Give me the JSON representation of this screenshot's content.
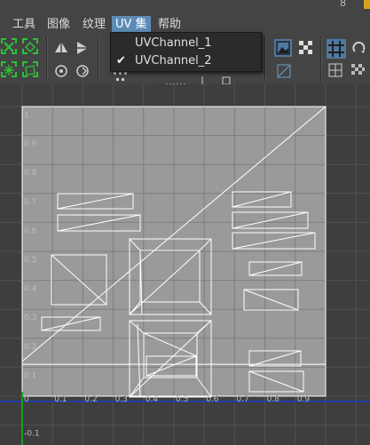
{
  "title_fragment": "8",
  "menu": [
    {
      "label": "工具",
      "active": false
    },
    {
      "label": "图像",
      "active": false
    },
    {
      "label": "纹理",
      "active": false
    },
    {
      "label": "UV 集",
      "active": true
    },
    {
      "label": "帮助",
      "active": false
    }
  ],
  "uv_set_menu": {
    "items": [
      {
        "label": "UVChannel_1",
        "checked": false
      },
      {
        "label": "UVChannel_2",
        "checked": true
      }
    ],
    "check_glyph": "✔"
  },
  "toolbar_icons": [
    "select-uv-icon",
    "select-face-icon",
    "shell-select-icon",
    "tile-select-icon",
    "flip-u-icon",
    "flip-v-icon",
    "rotate-ccw-icon",
    "rotate-cw-icon",
    "cut-icon",
    "sew-icon",
    "image-display-icon",
    "checker-icon",
    "snap-grid-icon",
    "redo-icon",
    "grid-icon",
    "shaded-icon"
  ],
  "uv_editor": {
    "axis_labels_u": [
      "0",
      "0.1",
      "0.2",
      "0.3",
      "0.4",
      "0.5",
      "0.6",
      "0.7",
      "0.8",
      "0.9"
    ],
    "axis_labels_v": [
      "0.1",
      "0.2",
      "0.3",
      "0.4",
      "0.5",
      "0.6",
      "0.7",
      "0.8",
      "0.9",
      "1"
    ],
    "below_zero_label": "-0.1",
    "colors": {
      "background": "#3e3e3e",
      "texture_tile": "#9a9a9a",
      "grid_line": "#7e7e7e",
      "uv_edges": "#ffffff",
      "u_axis": "#1f3fa6",
      "v_axis": "#1e9d1e"
    }
  }
}
